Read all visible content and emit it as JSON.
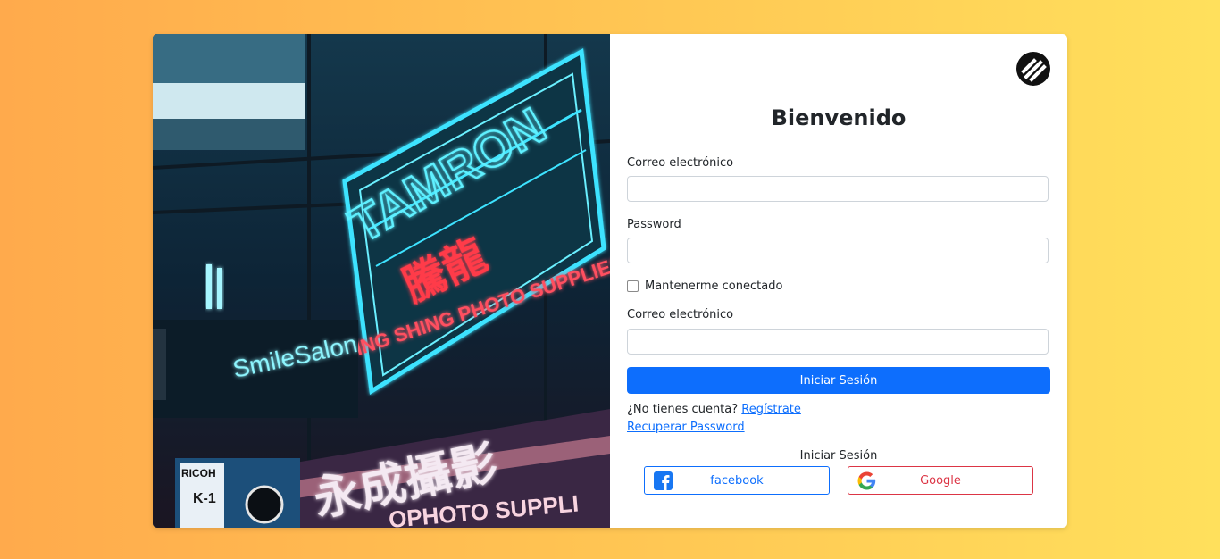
{
  "image": {
    "sign_brand": "TAMRON",
    "sign_chinese": "騰龍",
    "sign_english": "ING SHING PHOTO SUPPLIES",
    "sign_salon": "SmileSalon",
    "sign_bottom": "永成攝影",
    "sign_bottom_en": "OPHOTO SUPPLI",
    "ricoh": "RICOH",
    "k1": "K-1"
  },
  "form": {
    "title": "Bienvenido",
    "email_label": "Correo electrónico",
    "email_value": "",
    "password_label": "Password",
    "password_value": "",
    "remember_label": "Mantenerme conectado",
    "email2_label": "Correo electrónico",
    "email2_value": "",
    "submit_label": "Iniciar Sesión",
    "no_account_text": "¿No tienes cuenta?",
    "register_link": "Regístrate",
    "recover_link": "Recuperar Password",
    "social_label": "Iniciar Sesión",
    "facebook_label": "facebook",
    "google_label": "Google"
  },
  "colors": {
    "primary": "#0d6efd",
    "danger": "#dc3545",
    "background_start": "#ffaa4c",
    "background_end": "#ffe05c"
  },
  "icons": [
    "brand-logo-icon",
    "facebook-icon",
    "google-icon"
  ]
}
